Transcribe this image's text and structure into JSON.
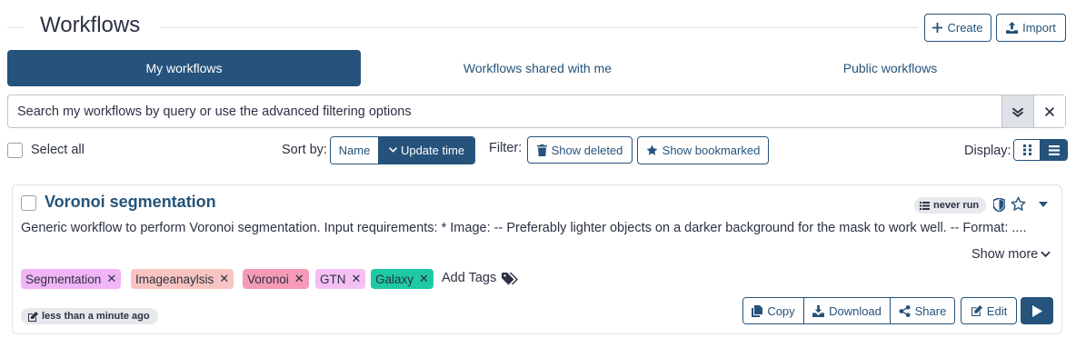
{
  "header": {
    "title": "Workflows",
    "create_label": "Create",
    "import_label": "Import"
  },
  "tabs": [
    {
      "label": "My workflows",
      "active": true
    },
    {
      "label": "Workflows shared with me",
      "active": false
    },
    {
      "label": "Public workflows",
      "active": false
    }
  ],
  "search": {
    "placeholder": "Search my workflows by query or use the advanced filtering options"
  },
  "controls": {
    "select_all_label": "Select all",
    "sort_label": "Sort by:",
    "sort_options": [
      "Name",
      "Update time"
    ],
    "sort_selected": "Update time",
    "filter_label": "Filter:",
    "show_deleted_label": "Show deleted",
    "show_bookmarked_label": "Show bookmarked",
    "display_label": "Display:",
    "display_selected": "list"
  },
  "workflow": {
    "title": "Voronoi segmentation",
    "run_status": "never run",
    "description": "Generic workflow to perform Voronoi segmentation. Input requirements: * Image: -- Preferably lighter objects on a darker background for the mask to work well. -- Format: ....",
    "show_more_label": "Show more",
    "tags": [
      {
        "label": "Segmentation",
        "color": "#f1b4f7"
      },
      {
        "label": "Imageanaylsis",
        "color": "#f8c4c1"
      },
      {
        "label": "Voronoi",
        "color": "#f59ab7"
      },
      {
        "label": "GTN",
        "color": "#f4bff3"
      },
      {
        "label": "Galaxy",
        "color": "#1fc9a6"
      }
    ],
    "add_tags_label": "Add Tags",
    "updated": "less than a minute ago",
    "actions": {
      "copy": "Copy",
      "download": "Download",
      "share": "Share",
      "edit": "Edit"
    }
  },
  "colors": {
    "primary": "#25537b",
    "text": "#2c3143",
    "border": "#dee2e6"
  }
}
